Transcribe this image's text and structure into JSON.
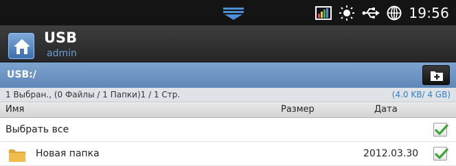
{
  "status_bar": {
    "time": "19:56",
    "icons": [
      "menu-handle-icon",
      "signal-bars-icon",
      "brightness-icon",
      "usb-icon",
      "globe-icon"
    ],
    "colors": {
      "background": "#141414",
      "handle": "#4d8fd6"
    }
  },
  "header": {
    "title": "USB",
    "user": "admin",
    "home_icon": "home-icon"
  },
  "path_bar": {
    "path": "USB:/",
    "new_folder_icon": "new-folder-icon"
  },
  "info_bar": {
    "selection_summary": "1 Выбран., (0 Файлы / 1 Папки)",
    "page": "1 / 1 Стр.",
    "capacity": "(4.0 KB/ 4 GB)"
  },
  "columns": {
    "name": "Имя",
    "size": "Размер",
    "date": "Дата"
  },
  "rows": {
    "select_all": {
      "label": "Выбрать все",
      "checked": true
    },
    "items": [
      {
        "name": "Новая папка",
        "size": "",
        "date": "2012.03.30",
        "type": "folder",
        "checked": true
      }
    ]
  },
  "colors": {
    "path_bar": "#6f96c4",
    "accent_blue": "#2f7ec3",
    "check_green": "#3aa63a"
  }
}
